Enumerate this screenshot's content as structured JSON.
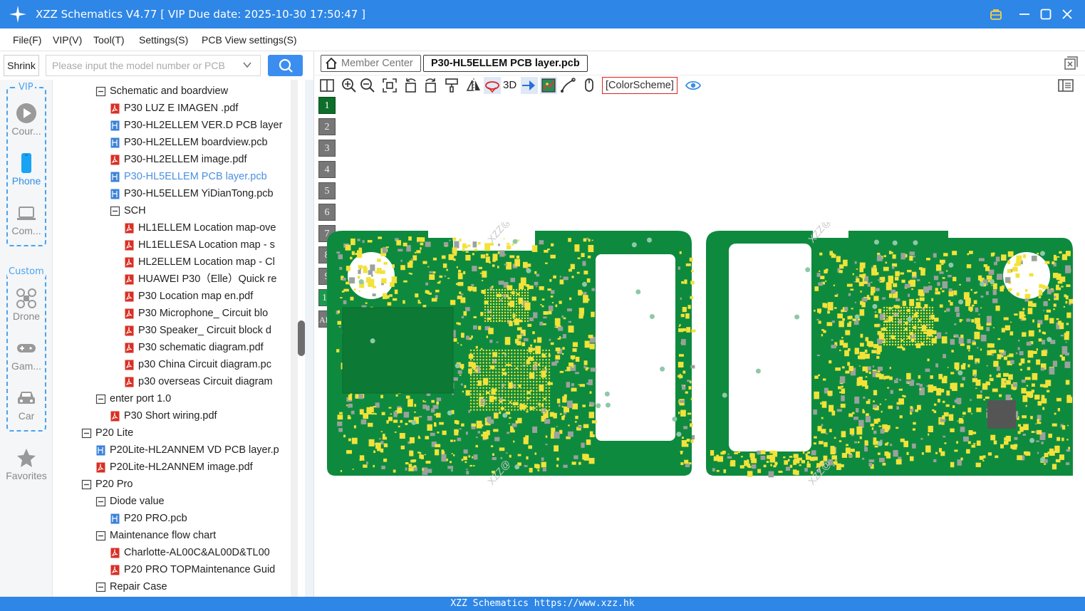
{
  "app": {
    "title": "XZZ Schematics V4.77 [ VIP Due date: 2025-10-30 17:50:47 ]"
  },
  "menu": [
    "File(F)",
    "VIP(V)",
    "Tool(T)",
    "Settings(S)",
    "PCB View settings(S)"
  ],
  "search": {
    "shrink_label": "Shrink",
    "placeholder": "Please input the model number or PCB"
  },
  "rail": {
    "vip_title": "VIP",
    "custom_title": "Custom",
    "items": [
      "Cour...",
      "Phone",
      "Com...",
      "Drone",
      "Gam...",
      "Car",
      "Favorites"
    ]
  },
  "tree": [
    {
      "label": "Schematic and boardview",
      "type": "folder",
      "level": 2
    },
    {
      "label": "P30 LUZ E IMAGEN .pdf",
      "type": "pdf",
      "level": 3
    },
    {
      "label": "P30-HL2ELLEM VER.D PCB layer",
      "type": "pcb",
      "level": 3
    },
    {
      "label": "P30-HL2ELLEM boardview.pcb",
      "type": "pcb",
      "level": 3
    },
    {
      "label": "P30-HL2ELLEM image.pdf",
      "type": "pdf",
      "level": 3
    },
    {
      "label": "P30-HL5ELLEM PCB layer.pcb",
      "type": "pcb",
      "level": 3,
      "selected": true
    },
    {
      "label": "P30-HL5ELLEM YiDianTong.pcb",
      "type": "pcb",
      "level": 3
    },
    {
      "label": "SCH",
      "type": "folder",
      "level": 3
    },
    {
      "label": "HL1ELLEM Location map-ove",
      "type": "pdf",
      "level": 4
    },
    {
      "label": "HL1ELLESA Location map - s",
      "type": "pdf",
      "level": 4
    },
    {
      "label": "HL2ELLEM Location map - Cl",
      "type": "pdf",
      "level": 4
    },
    {
      "label": "HUAWEI P30（Elle）Quick re",
      "type": "pdf",
      "level": 4
    },
    {
      "label": "P30 Location map en.pdf",
      "type": "pdf",
      "level": 4
    },
    {
      "label": "P30 Microphone_ Circuit blo",
      "type": "pdf",
      "level": 4
    },
    {
      "label": "P30 Speaker_ Circuit block d",
      "type": "pdf",
      "level": 4
    },
    {
      "label": "P30 schematic diagram.pdf",
      "type": "pdf",
      "level": 4
    },
    {
      "label": "p30 China Circuit diagram.pc",
      "type": "pdf",
      "level": 4
    },
    {
      "label": "p30 overseas Circuit diagram",
      "type": "pdf",
      "level": 4
    },
    {
      "label": "enter port 1.0",
      "type": "folder",
      "level": 2
    },
    {
      "label": "P30 Short wiring.pdf",
      "type": "pdf",
      "level": 3
    },
    {
      "label": "P20 Lite",
      "type": "folder",
      "level": 1
    },
    {
      "label": "P20Lite-HL2ANNEM VD PCB layer.p",
      "type": "pcb",
      "level": 2
    },
    {
      "label": "P20Lite-HL2ANNEM image.pdf",
      "type": "pdf",
      "level": 2
    },
    {
      "label": "P20 Pro",
      "type": "folder",
      "level": 1
    },
    {
      "label": "Diode value",
      "type": "folder",
      "level": 2
    },
    {
      "label": "P20 PRO.pcb",
      "type": "pcb",
      "level": 3
    },
    {
      "label": "Maintenance flow chart",
      "type": "folder",
      "level": 2
    },
    {
      "label": "Charlotte-AL00C&AL00D&TL00",
      "type": "pdf",
      "level": 3
    },
    {
      "label": "P20 PRO TOPMaintenance Guid",
      "type": "pdf",
      "level": 3
    },
    {
      "label": "Repair Case",
      "type": "folder",
      "level": 2
    }
  ],
  "tabs": {
    "member": "Member Center",
    "active": "P30-HL5ELLEM PCB layer.pcb"
  },
  "toolbar": {
    "three_d": "3D",
    "colorscheme": "[ColorScheme]"
  },
  "layers": [
    "1",
    "2",
    "3",
    "4",
    "5",
    "6",
    "7",
    "8",
    "9",
    "10",
    "ALL"
  ],
  "watermark": "XZZ@XZZHK",
  "watermark_short": "XZZ@",
  "footer": "XZZ Schematics https://www.xzz.hk",
  "colors": {
    "brand": "#2e86e6",
    "pcb_green": "#0e8a3e",
    "pad_yellow": "#f2e23a",
    "layer_active": "#0e6e2a"
  }
}
